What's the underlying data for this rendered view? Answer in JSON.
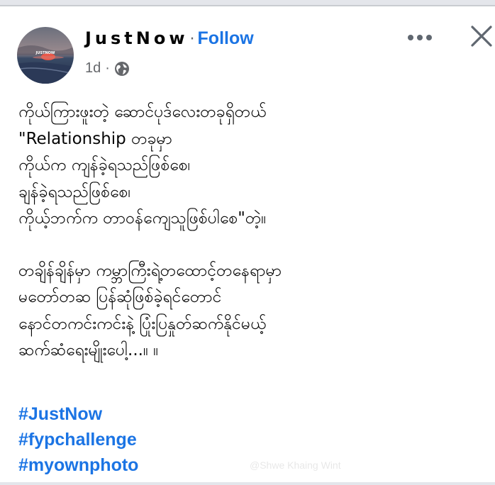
{
  "post": {
    "author": "JustNow",
    "dot_separator": "·",
    "follow_label": "Follow",
    "timestamp": "1d",
    "meta_dot": "·",
    "privacy_icon": "globe-icon",
    "more_icon": "more-horizontal-icon",
    "close_icon": "close-icon",
    "avatar_label": "JUSTNOW",
    "body_lines": [
      "ကိုယ်ကြားဖူးတဲ့ ဆောင်ပုဒ်လေးတခုရှိတယ်",
      "\"Relationship တခုမှာ",
      "ကိုယ်က ကျန်ခဲ့ရသည်ဖြစ်စေ၊",
      "ချန်ခဲ့ရသည်ဖြစ်စေ၊",
      "ကိုယ့်ဘက်က တာဝန်ကျေသူဖြစ်ပါစေ\"တဲ့။",
      "",
      "တချိန်ချိန်မှာ ကမ္ဘာကြီးရဲ့တထောင့်တနေရာမှာ",
      "မတော်တဆ ပြန်ဆုံဖြစ်ခဲ့ရင်တောင်",
      "နောင်တကင်းကင်းနဲ့ ပြုံးပြနှုတ်ဆက်နိုင်မယ့်",
      "ဆက်ဆံရေးမျိုးပေါ့...။      ။"
    ],
    "hashtags": [
      "#JustNow",
      "#fypchallenge",
      "#myownphoto"
    ],
    "watermark": "@Shwe Khaing Wint"
  },
  "colors": {
    "link": "#1b74e4",
    "text": "#050505",
    "secondary": "#65676b"
  }
}
